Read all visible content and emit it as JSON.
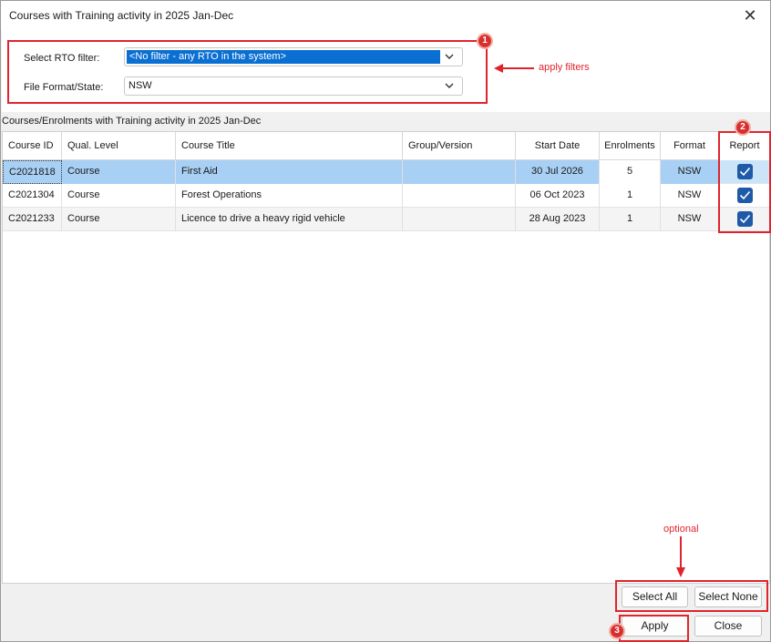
{
  "window": {
    "title": "Courses with Training activity in 2025 Jan-Dec",
    "close_glyph": "✕"
  },
  "filters": {
    "rto_label": "Select RTO filter:",
    "rto_value": "<No filter - any RTO in the system>",
    "format_label": "File Format/State:",
    "format_value": "NSW"
  },
  "grid": {
    "title": "Courses/Enrolments with Training activity in 2025 Jan-Dec",
    "columns": [
      "Course ID",
      "Qual. Level",
      "Course Title",
      "Group/Version",
      "Start Date",
      "Enrolments",
      "Format",
      "Report"
    ],
    "rows": [
      {
        "course_id": "C2021818",
        "level": "Course",
        "title": "First Aid",
        "group": "",
        "start_date": "30 Jul 2026",
        "enrolments": "5",
        "format": "NSW",
        "report": true
      },
      {
        "course_id": "C2021304",
        "level": "Course",
        "title": "Forest Operations",
        "group": "",
        "start_date": "06 Oct 2023",
        "enrolments": "1",
        "format": "NSW",
        "report": true
      },
      {
        "course_id": "C2021233",
        "level": "Course",
        "title": "Licence to drive a heavy rigid vehicle",
        "group": "",
        "start_date": "28 Aug 2023",
        "enrolments": "1",
        "format": "NSW",
        "report": true
      }
    ]
  },
  "buttons": {
    "select_all": "Select All",
    "select_none": "Select None",
    "apply": "Apply",
    "close": "Close"
  },
  "annotations": {
    "badge1": "1",
    "badge2": "2",
    "badge3": "3",
    "apply_filters": "apply filters",
    "optional": "optional",
    "color": "#e0242d"
  }
}
